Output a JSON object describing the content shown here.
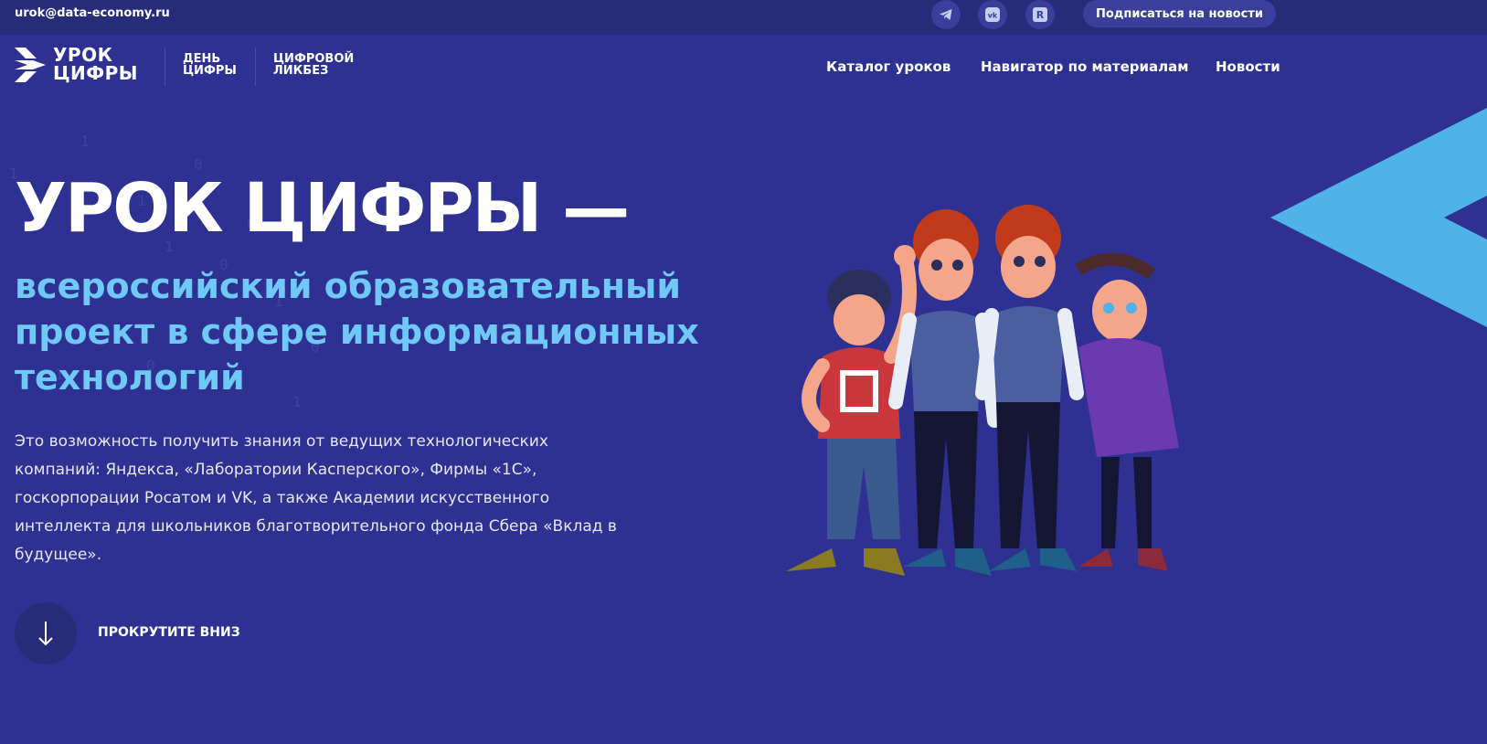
{
  "topbar": {
    "email": "urok@data-economy.ru",
    "social": [
      {
        "icon": "telegram-icon"
      },
      {
        "icon": "vk-icon"
      },
      {
        "icon": "rutube-icon"
      }
    ],
    "subscribe_label": "Подписаться на новости"
  },
  "header": {
    "logo_line1": "УРОК",
    "logo_line2": "ЦИФРЫ",
    "sublogo1": "ДЕНЬ\nЦИФРЫ",
    "sublogo2": "ЦИФРОВОЙ\nЛИКБЕЗ",
    "nav": [
      {
        "label": "Каталог уроков"
      },
      {
        "label": "Навигатор по материалам"
      },
      {
        "label": "Новости"
      }
    ]
  },
  "hero": {
    "title": "УРОК ЦИФРЫ —",
    "subtitle": "всероссийский образовательный проект в сфере информационных технологий",
    "description": "Это возможность получить знания от ведущих технологических компаний: Яндекса, «Лаборатории Касперского», Фирмы «1С», госкорпорации Росатом и VK, а также Академии искусственного интеллекта для школьников благотворительного фонда Сбера «Вклад в будущее».",
    "scroll_label": "ПРОКРУТИТЕ ВНИЗ"
  },
  "colors": {
    "background": "#2e3192",
    "topbar": "#262b7a",
    "accent_blue": "#6fc8f5",
    "triangle": "#4fb3e8"
  }
}
